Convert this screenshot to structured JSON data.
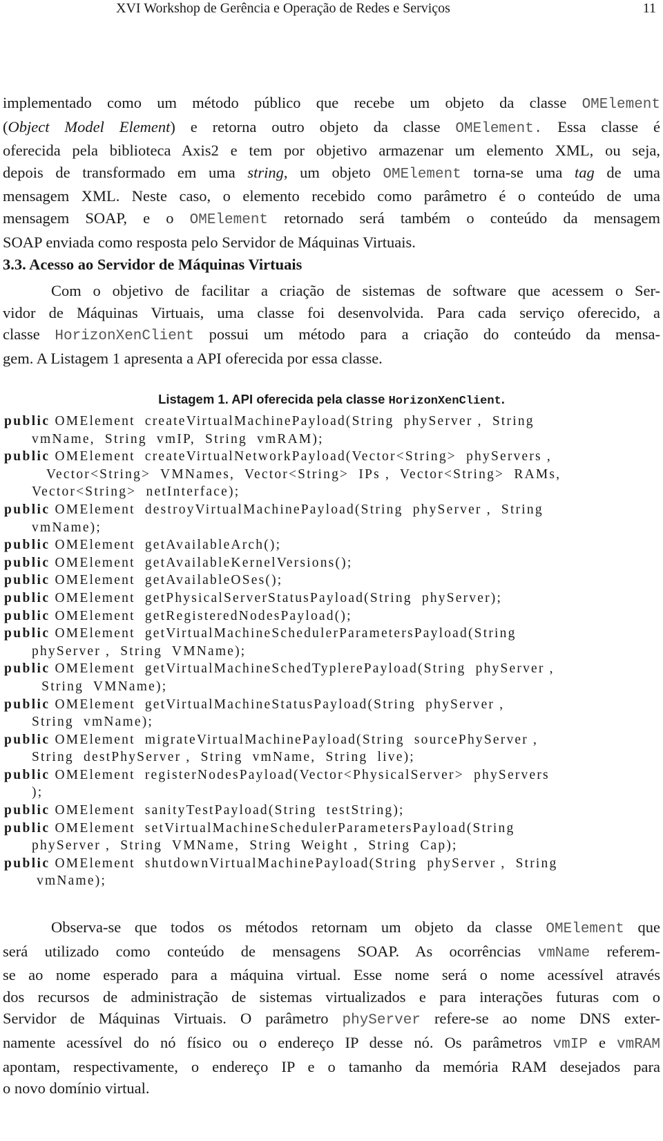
{
  "running_head": {
    "title": "XVI Workshop de Gerência e Operação de Redes e Serviços",
    "page_number": "11"
  },
  "para1": {
    "lines": [
      [
        {
          "t": "implementado como um método público que recebe um objeto da classe "
        },
        {
          "code": "OMElement"
        }
      ],
      [
        {
          "t": "("
        },
        {
          "i": "Object Model Element"
        },
        {
          "t": ") e retorna outro objeto da classe "
        },
        {
          "code": "OMElement."
        },
        {
          "t": "  Essa classe é"
        }
      ],
      [
        {
          "t": "oferecida pela biblioteca Axis2 e tem por objetivo armazenar um elemento XML, ou seja,"
        }
      ],
      [
        {
          "t": "depois de transformado em uma "
        },
        {
          "i": "string"
        },
        {
          "t": ", um objeto "
        },
        {
          "code": "OMElement"
        },
        {
          "t": " torna-se uma "
        },
        {
          "i": "tag"
        },
        {
          "t": " de uma"
        }
      ],
      [
        {
          "t": "mensagem XML. Neste caso, o elemento recebido como parâmetro é o conteúdo de uma"
        }
      ],
      [
        {
          "t": "mensagem SOAP, e o "
        },
        {
          "code": "OMElement"
        },
        {
          "t": " retornado será também o conteúdo da mensagem"
        }
      ],
      [
        {
          "t": "SOAP enviada como resposta pelo Servidor de Máquinas Virtuais."
        }
      ]
    ]
  },
  "section": {
    "number": "3.3.",
    "title": "Acesso ao Servidor de Máquinas Virtuais"
  },
  "para2": {
    "lines": [
      [
        {
          "t": "Com o objetivo de facilitar a criação de sistemas de software que acessem o Ser-"
        }
      ],
      [
        {
          "t": "vidor de Máquinas Virtuais, uma classe foi desenvolvida.  Para cada serviço oferecido, a"
        }
      ],
      [
        {
          "t": "classe "
        },
        {
          "code": "HorizonXenClient"
        },
        {
          "t": " possui um método para a criação do conteúdo da mensa-"
        }
      ],
      [
        {
          "t": "gem. A Listagem 1 apresenta a API oferecida por essa classe."
        }
      ]
    ]
  },
  "listing": {
    "caption_text": "Listagem 1. API oferecida pela classe ",
    "caption_code": "HorizonXenClient",
    "caption_end": ".",
    "keyword": "public",
    "lines": [
      {
        "kw": true,
        "text": " OMElement  createVirtualMachinePayload(String  phyServer ,  String"
      },
      {
        "kw": false,
        "text": "vmName,  String  vmIP,  String  vmRAM);"
      },
      {
        "kw": true,
        "text": " OMElement  createVirtualNetworkPayload(Vector<String>  phyServers ,"
      },
      {
        "kw": false,
        "text": "   Vector<String>  VMNames,  Vector<String>  IPs ,  Vector<String>  RAMs,"
      },
      {
        "kw": false,
        "text": "Vector<String>  netInterface);"
      },
      {
        "kw": true,
        "text": " OMElement  destroyVirtualMachinePayload(String  phyServer ,  String"
      },
      {
        "kw": false,
        "text": "vmName);"
      },
      {
        "kw": true,
        "text": " OMElement  getAvailableArch();"
      },
      {
        "kw": true,
        "text": " OMElement  getAvailableKernelVersions();"
      },
      {
        "kw": true,
        "text": " OMElement  getAvailableOSes();"
      },
      {
        "kw": true,
        "text": " OMElement  getPhysicalServerStatusPayload(String  phyServer);"
      },
      {
        "kw": true,
        "text": " OMElement  getRegisteredNodesPayload();"
      },
      {
        "kw": true,
        "text": " OMElement  getVirtualMachineSchedulerParametersPayload(String"
      },
      {
        "kw": false,
        "text": "phyServer ,  String  VMName);"
      },
      {
        "kw": true,
        "text": " OMElement  getVirtualMachineSchedTyplerePayload(String  phyServer ,"
      },
      {
        "kw": false,
        "text": "  String  VMName);"
      },
      {
        "kw": true,
        "text": " OMElement  getVirtualMachineStatusPayload(String  phyServer ,"
      },
      {
        "kw": false,
        "text": "String  vmName);"
      },
      {
        "kw": true,
        "text": " OMElement  migrateVirtualMachinePayload(String  sourcePhyServer ,"
      },
      {
        "kw": false,
        "text": "String  destPhyServer ,  String  vmName,  String  live);"
      },
      {
        "kw": true,
        "text": " OMElement  registerNodesPayload(Vector<PhysicalServer>  phyServers"
      },
      {
        "kw": false,
        "text": ");"
      },
      {
        "kw": true,
        "text": " OMElement  sanityTestPayload(String  testString);"
      },
      {
        "kw": true,
        "text": " OMElement  setVirtualMachineSchedulerParametersPayload(String"
      },
      {
        "kw": false,
        "text": "phyServer ,  String  VMName,  String  Weight ,  String  Cap);"
      },
      {
        "kw": true,
        "text": " OMElement  shutdownVirtualMachinePayload(String  phyServer ,  String"
      },
      {
        "kw": false,
        "text": " vmName);"
      }
    ]
  },
  "para3": {
    "lines": [
      [
        {
          "t": "Observa-se que todos os métodos retornam um objeto da classe "
        },
        {
          "code": "OMElement"
        },
        {
          "t": " que"
        }
      ],
      [
        {
          "t": "será utilizado como conteúdo de mensagens SOAP. As ocorrências "
        },
        {
          "code": "vmName"
        },
        {
          "t": " referem-"
        }
      ],
      [
        {
          "t": "se ao nome esperado para a máquina virtual.  Esse nome será o nome acessível através"
        }
      ],
      [
        {
          "t": "dos recursos de administração de sistemas virtualizados e para interações futuras com o"
        }
      ],
      [
        {
          "t": "Servidor de Máquinas Virtuais. O parâmetro "
        },
        {
          "code": "phyServer"
        },
        {
          "t": " refere-se ao nome DNS exter-"
        }
      ],
      [
        {
          "t": "namente acessível do nó físico ou o endereço IP desse nó. Os parâmetros "
        },
        {
          "code": "vmIP"
        },
        {
          "t": " e "
        },
        {
          "code": "vmRAM"
        }
      ],
      [
        {
          "t": "apontam, respectivamente, o endereço IP e o tamanho da memória RAM desejados para"
        }
      ],
      [
        {
          "t": "o novo domínio virtual."
        }
      ]
    ]
  }
}
